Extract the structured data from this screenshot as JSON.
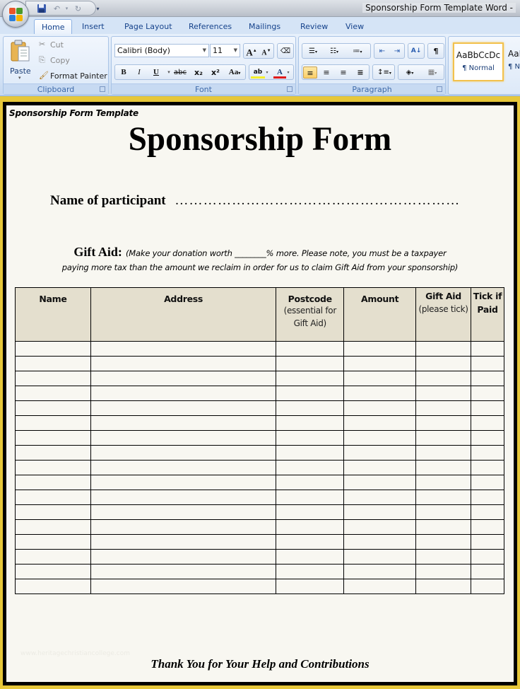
{
  "window": {
    "title": "Sponsorship Form Template Word -"
  },
  "quick_access": {
    "save": "save-icon",
    "undo": "undo-icon",
    "redo": "redo-icon",
    "customize": "customize-icon"
  },
  "tabs": [
    {
      "label": "Home",
      "active": true
    },
    {
      "label": "Insert",
      "active": false
    },
    {
      "label": "Page Layout",
      "active": false
    },
    {
      "label": "References",
      "active": false
    },
    {
      "label": "Mailings",
      "active": false
    },
    {
      "label": "Review",
      "active": false
    },
    {
      "label": "View",
      "active": false
    }
  ],
  "ribbon": {
    "clipboard": {
      "label": "Clipboard",
      "paste": "Paste",
      "cut": "Cut",
      "copy": "Copy",
      "format_painter": "Format Painter"
    },
    "font": {
      "label": "Font",
      "font_name": "Calibri (Body)",
      "font_size": "11",
      "bold": "B",
      "italic": "I",
      "underline": "U",
      "strikethrough": "abc",
      "subscript": "x₂",
      "superscript": "x²",
      "change_case": "Aa",
      "grow": "A",
      "shrink": "A",
      "highlight_color": "#f5ef2b",
      "font_color": "#e01a1a"
    },
    "paragraph": {
      "label": "Paragraph"
    },
    "styles": [
      {
        "preview": "AaBbCcDc",
        "name": "¶ Normal",
        "active": true
      },
      {
        "preview": "AaBbCcDc",
        "name": "¶ No Spacing",
        "active": false
      }
    ]
  },
  "document": {
    "label": "Sponsorship  Form Template",
    "title": "Sponsorship Form",
    "participant_label": "Name of participant",
    "participant_dots": "……………………………………………………",
    "gift_aid_label": "Gift Aid:",
    "gift_aid_note_1": "(Make your donation worth ________% more.  Please note, you must be a taxpayer",
    "gift_aid_note_2": "paying more tax than the amount we reclaim in order for us to claim Gift Aid from your sponsorship)",
    "table": {
      "columns": [
        {
          "title": "Name",
          "sub": ""
        },
        {
          "title": "Address",
          "sub": ""
        },
        {
          "title": "Postcode",
          "sub": "(essential for Gift Aid)"
        },
        {
          "title": "Amount",
          "sub": ""
        },
        {
          "title": "Gift Aid",
          "sub": "(please tick)"
        },
        {
          "title": "Tick if Paid",
          "sub": ""
        }
      ],
      "rows": [
        [
          "",
          "",
          "",
          "",
          "",
          ""
        ],
        [
          "",
          "",
          "",
          "",
          "",
          ""
        ],
        [
          "",
          "",
          "",
          "",
          "",
          ""
        ],
        [
          "",
          "",
          "",
          "",
          "",
          ""
        ],
        [
          "",
          "",
          "",
          "",
          "",
          ""
        ],
        [
          "",
          "",
          "",
          "",
          "",
          ""
        ],
        [
          "",
          "",
          "",
          "",
          "",
          ""
        ],
        [
          "",
          "",
          "",
          "",
          "",
          ""
        ],
        [
          "",
          "",
          "",
          "",
          "",
          ""
        ],
        [
          "",
          "",
          "",
          "",
          "",
          ""
        ],
        [
          "",
          "",
          "",
          "",
          "",
          ""
        ],
        [
          "",
          "",
          "",
          "",
          "",
          ""
        ],
        [
          "",
          "",
          "",
          "",
          "",
          ""
        ],
        [
          "",
          "",
          "",
          "",
          "",
          ""
        ],
        [
          "",
          "",
          "",
          "",
          "",
          ""
        ],
        [
          "",
          "",
          "",
          "",
          "",
          ""
        ],
        [
          "",
          "",
          "",
          "",
          "",
          ""
        ]
      ]
    },
    "watermark": "www.heritagechristiancollege.com",
    "footer": "Thank You for Your Help and Contributions"
  }
}
